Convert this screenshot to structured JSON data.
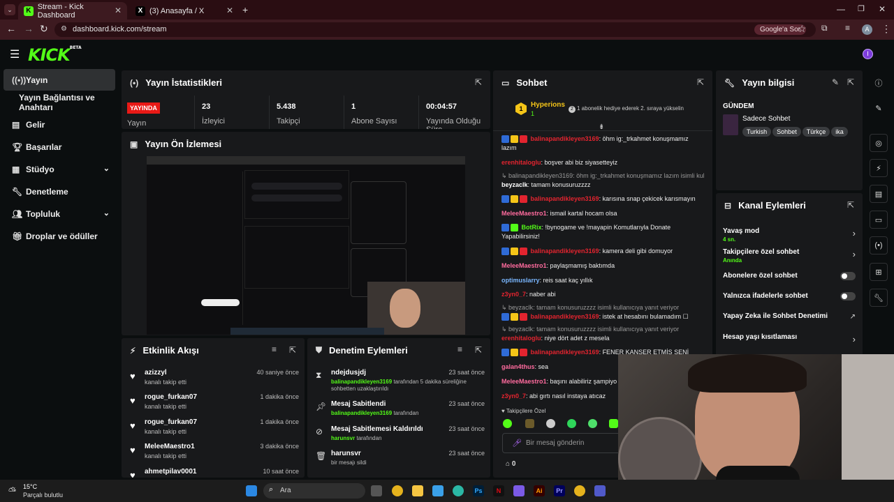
{
  "browser": {
    "tabs": [
      {
        "title": "Stream - Kick Dashboard"
      },
      {
        "title": "(3) Anasayfa / X"
      }
    ],
    "url": "dashboard.kick.com/stream",
    "google_label": "Google'a Sor",
    "profile_initial": "A"
  },
  "app": {
    "logo": "KICK",
    "logo_sup": "BETA",
    "user_initial": "I"
  },
  "sidebar": {
    "items": [
      {
        "label": "Yayın",
        "icon": "broadcast-icon"
      },
      {
        "label": "Yayın Bağlantısı ve Anahtarı"
      },
      {
        "label": "Gelir",
        "icon": "wallet-icon"
      },
      {
        "label": "Başarılar",
        "icon": "trophy-icon"
      },
      {
        "label": "Stüdyo",
        "icon": "studio-icon"
      },
      {
        "label": "Denetleme",
        "icon": "wrench-icon"
      },
      {
        "label": "Topluluk",
        "icon": "people-icon"
      },
      {
        "label": "Droplar ve ödüller",
        "icon": "gift-icon"
      }
    ]
  },
  "stats": {
    "title": "Yayın İstatistikleri",
    "live_badge": "YAYINDA",
    "live_label": "Yayın",
    "items": [
      {
        "value": "23",
        "label": "İzleyici"
      },
      {
        "value": "5.438",
        "label": "Takipçi"
      },
      {
        "value": "1",
        "label": "Abone Sayısı"
      },
      {
        "value": "00:04:57",
        "label": "Yayında Olduğu Süre"
      }
    ]
  },
  "preview": {
    "title": "Yayın Ön İzlemesi"
  },
  "activity": {
    "title": "Etkinlik Akışı",
    "items": [
      {
        "name": "azizzyl",
        "action": "kanalı takip etti",
        "time": "40 saniye önce"
      },
      {
        "name": "rogue_furkan07",
        "action": "kanalı takip etti",
        "time": "1 dakika önce"
      },
      {
        "name": "rogue_furkan07",
        "action": "kanalı takip etti",
        "time": "1 dakika önce"
      },
      {
        "name": "MeleeMaestro1",
        "action": "kanalı takip etti",
        "time": "3 dakika önce"
      },
      {
        "name": "ahmetpilav0001",
        "action": "",
        "time": "10 saat önce"
      }
    ]
  },
  "modlog": {
    "title": "Denetim Eylemleri",
    "items": [
      {
        "name": "ndejdusjdj",
        "user": "balinapandikleyen3169",
        "desc": "tarafından 5 dakika süreliğine sohbetten uzaklaştırıldı",
        "time": "23 saat önce",
        "icon": "hourglass-icon"
      },
      {
        "name": "Mesaj Sabitlendi",
        "user": "balinapandikleyen3169",
        "desc": "tarafından",
        "time": "23 saat önce",
        "icon": "pin-icon"
      },
      {
        "name": "Mesaj Sabitlemesi Kaldırıldı",
        "user": "harunsvr",
        "desc": "tarafından",
        "time": "23 saat önce",
        "icon": "unpin-icon"
      },
      {
        "name": "harunsvr",
        "user": "",
        "desc": "bir mesajı sildi",
        "time": "23 saat önce",
        "icon": "trash-icon"
      }
    ]
  },
  "chat": {
    "title": "Sohbet",
    "top_gifter": "Hyperions",
    "top_gifter_rank": "1",
    "top_gifter_count": "1",
    "gift_note": "1 abonelik hediye ederek 2. sıraya yükselin",
    "messages": [
      {
        "user": "balinapandikleyen3169",
        "text": ": öhm ig:_trkahmet konuşmamız lazım",
        "color": "#e2242f"
      },
      {
        "user": "erenhitaloglu",
        "text": ": boşver abi biz siyasetteyiz",
        "color": "#e2242f"
      },
      {
        "reply": "balinapandikleyen3169: öhm ig:_trkahmet konuşmamız lazım isimli kull..."
      },
      {
        "user": "beyzaclk",
        "text": ": tamam konusuruzzzz",
        "color": "#ffffff"
      },
      {
        "user": "balinapandikleyen3169",
        "text": ": karısına snap çekicek karısmayın",
        "color": "#e2242f"
      },
      {
        "user": "MeleeMaestro1",
        "text": ": ismail kartal hocam olsa",
        "color": "#ff6b9e"
      },
      {
        "user": "BotRix",
        "text": ": !bynogame ve !mayapin Komutlarıyla Donate Yapabilirsiniz!",
        "color": "#53fc18"
      },
      {
        "user": "balinapandikleyen3169",
        "text": ": kamera deli gibi domuyor",
        "color": "#e2242f"
      },
      {
        "user": "MeleeMaestro1",
        "text": ": paylaşmamış baktımda",
        "color": "#ff6b9e"
      },
      {
        "user": "optimuslarry",
        "text": ": reis saat kaç yıllık",
        "color": "#7ab7ff"
      },
      {
        "user": "z3yn0_7",
        "text": ": naber abi",
        "color": "#e2242f"
      },
      {
        "reply": "beyzaclk: tamam konusuruzzzz isimli kullanıcıya yanıt veriyor"
      },
      {
        "user": "balinapandikleyen3169",
        "text": ": istek at hesabını bulamadım ☐",
        "color": "#e2242f"
      },
      {
        "reply": "beyzaclk: tamam konusuruzzzz isimli kullanıcıya yanıt veriyor"
      },
      {
        "user": "erenhitaloglu",
        "text": ": niye dört adet z mesela",
        "color": "#e2242f"
      },
      {
        "user": "balinapandikleyen3169",
        "text": ": FENER KANSER ETMİŞ SENİ",
        "color": "#e2242f"
      },
      {
        "user": "galan4thus",
        "text": ": sea",
        "color": "#ff6b9e"
      },
      {
        "user": "MeleeMaestro1",
        "text": ": başını alabiliriz şampiyo",
        "color": "#ff6b9e"
      },
      {
        "user": "z3yn0_7",
        "text": ": abi gırtı nasıl instaya atıcaz",
        "color": "#e2242f"
      }
    ],
    "followers_only": "Takipçilere Özel",
    "input_placeholder": "Bir mesaj gönderin",
    "bottom_count": "0"
  },
  "info": {
    "title": "Yayın bilgisi",
    "section": "GÜNDEM",
    "category": "Sadece Sohbet",
    "tags": [
      "Turkish",
      "Sohbet",
      "Türkçe",
      "ika"
    ]
  },
  "channel_actions": {
    "title": "Kanal Eylemleri",
    "items": [
      {
        "label": "Yavaş mod",
        "sub": "4 sn.",
        "control": "chevron"
      },
      {
        "label": "Takipçilere özel sohbet",
        "sub": "Anında",
        "control": "chevron"
      },
      {
        "label": "Abonelere özel sohbet",
        "sub": "",
        "control": "toggle"
      },
      {
        "label": "Yalnızca ifadelerle sohbet",
        "sub": "",
        "control": "toggle"
      },
      {
        "label": "Yapay Zeka ile Sohbet Denetimi",
        "sub": "",
        "control": "external"
      },
      {
        "label": "Hesap yaşı kısıtlaması",
        "sub": "",
        "control": "chevron"
      }
    ]
  },
  "taskbar": {
    "weather_temp": "15°C",
    "weather_desc": "Parçalı bulutlu",
    "search_placeholder": "Ara"
  }
}
